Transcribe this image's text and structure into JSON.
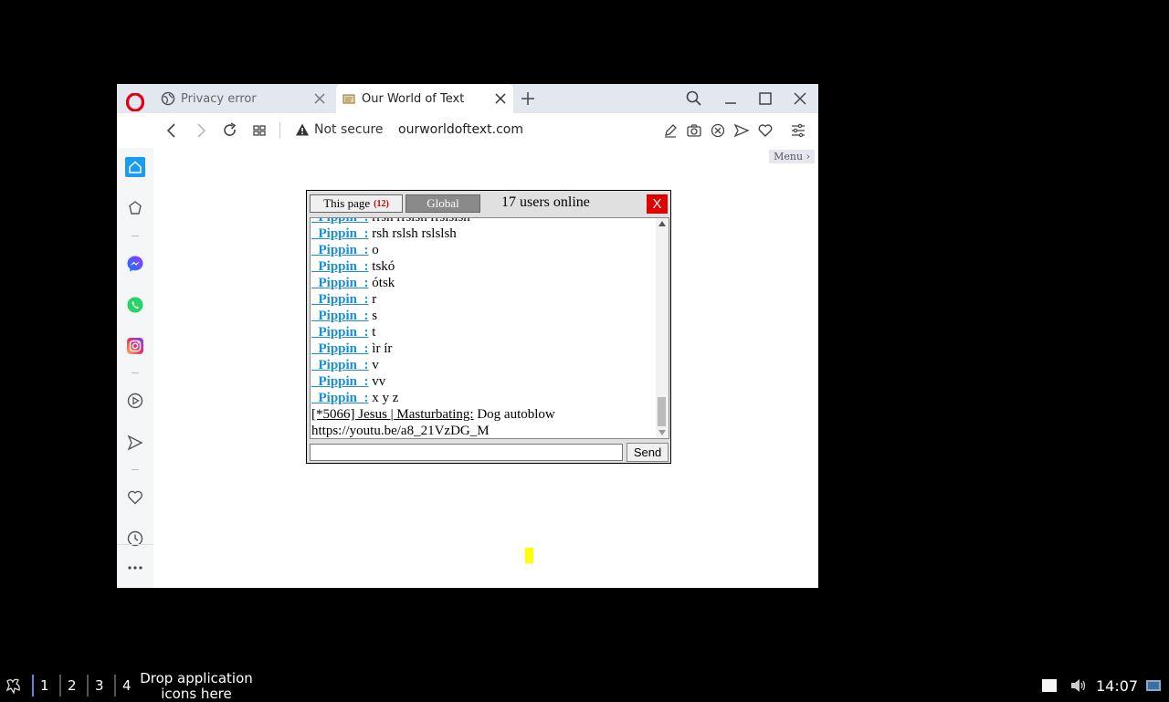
{
  "browser": {
    "tabs": [
      {
        "title": "Privacy error"
      },
      {
        "title": "Our World of Text"
      }
    ],
    "security_label": "Not secure",
    "url": "ourworldoftext.com"
  },
  "page": {
    "menu_label": "Menu"
  },
  "chat": {
    "tab_page_label": "This page",
    "tab_page_count": "(12)",
    "tab_global_label": "Global",
    "online_text": "17 users online",
    "close_label": "X",
    "send_label": "Send",
    "messages": [
      {
        "nick": "_Pippin_:",
        "text": " rrsh rrslsh rrslslsh"
      },
      {
        "nick": "_Pippin_:",
        "text": " rsh rslsh rslslsh"
      },
      {
        "nick": "_Pippin_:",
        "text": " o"
      },
      {
        "nick": "_Pippin_:",
        "text": " tskó"
      },
      {
        "nick": "_Pippin_:",
        "text": " ótsk"
      },
      {
        "nick": "_Pippin_:",
        "text": " r"
      },
      {
        "nick": "_Pippin_:",
        "text": " s"
      },
      {
        "nick": "_Pippin_:",
        "text": " t"
      },
      {
        "nick": "_Pippin_:",
        "text": " ìr ír"
      },
      {
        "nick": "_Pippin_:",
        "text": " v"
      },
      {
        "nick": "_Pippin_:",
        "text": " vv"
      },
      {
        "nick": "_Pippin_:",
        "text": " x y z"
      }
    ],
    "last_message": {
      "nick": "[*5066] Jesus | Masturbating:",
      "text": " Dog autoblow",
      "text2": "https://youtu.be/a8_21VzDG_M"
    }
  },
  "taskbar": {
    "workspaces": [
      "1",
      "2",
      "3",
      "4"
    ],
    "drop_text": "Drop application icons here",
    "clock": "14:07"
  },
  "colors": {
    "opera_red": "#e0001a",
    "chat_nick_blue": "#1a8fd6",
    "close_red": "#e00000",
    "sidebar_active": "#1a9bf0"
  }
}
